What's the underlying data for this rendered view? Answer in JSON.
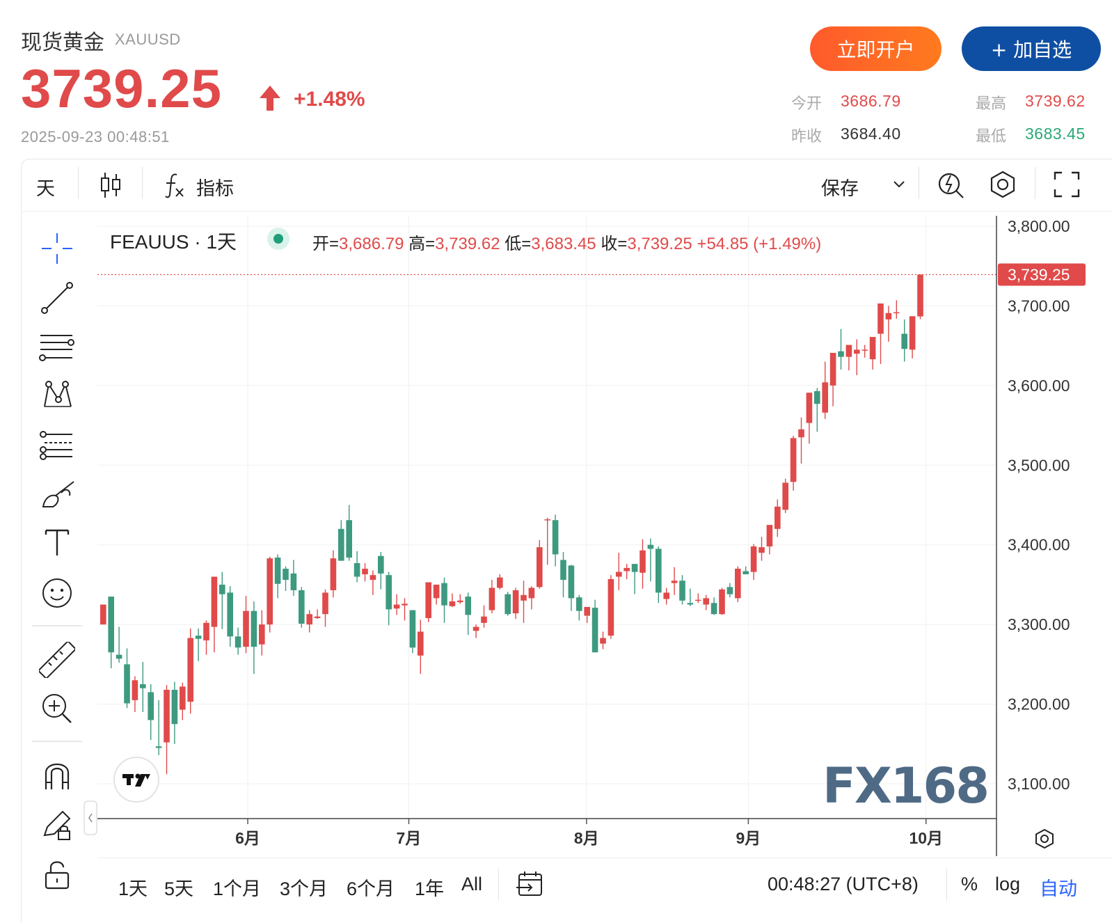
{
  "header": {
    "name": "现货黄金",
    "symbol": "XAUUSD",
    "price": "3739.25",
    "change_pct": "+1.48%",
    "timestamp": "2025-09-23 00:48:51",
    "open_label": "今开",
    "open_value": "3686.79",
    "prev_close_label": "昨收",
    "prev_close_value": "3684.40",
    "high_label": "最高",
    "high_value": "3739.62",
    "low_label": "最低",
    "low_value": "3683.45",
    "btn_open_account": "立即开户",
    "btn_watchlist": "+ 加自选"
  },
  "toolbar": {
    "interval": "天",
    "indicators": "指标",
    "save": "保存"
  },
  "legend": {
    "title": "FEAUUS · 1天",
    "o_label": "开=",
    "o": "3,686.79",
    "h_label": "高=",
    "h": "3,739.62",
    "l_label": "低=",
    "l": "3,683.45",
    "c_label": "收=",
    "c": "3,739.25",
    "chg": "+54.85 (+1.49%)"
  },
  "bottom": {
    "ranges": [
      "1天",
      "5天",
      "1个月",
      "3个月",
      "6个月",
      "1年",
      "All"
    ],
    "clock": "00:48:27 (UTC+8)",
    "pct": "%",
    "log": "log",
    "auto": "自动"
  },
  "watermark": "FX168",
  "colors": {
    "up": "#e04a4a",
    "down": "#3d9a7f",
    "accent": "#0f4fa3",
    "orange": "#ff6a24"
  },
  "chart_data": {
    "type": "candlestick",
    "price_axis": {
      "ticks": [
        3100,
        3200,
        3300,
        3400,
        3500,
        3600,
        3700,
        3800
      ],
      "tick_labels": [
        "3,100.00",
        "3,200.00",
        "3,300.00",
        "3,400.00",
        "3,500.00",
        "3,600.00",
        "3,700.00",
        "3,800.00"
      ],
      "range": [
        3060,
        3815
      ],
      "last_price_label": "3,739.25",
      "last_price": 3739.25
    },
    "time_axis": {
      "labels": [
        "6月",
        "7月",
        "8月",
        "9月",
        "10月"
      ],
      "label_bar_index": [
        18.6,
        38.9,
        61.3,
        81.7,
        104.1
      ]
    },
    "candles": [
      {
        "o": 3300,
        "h": 3325,
        "l": 3300,
        "c": 3325
      },
      {
        "o": 3335,
        "h": 3335,
        "l": 3245,
        "c": 3265
      },
      {
        "o": 3262,
        "h": 3297,
        "l": 3252,
        "c": 3257
      },
      {
        "o": 3250,
        "h": 3270,
        "l": 3195,
        "c": 3201
      },
      {
        "o": 3205,
        "h": 3235,
        "l": 3190,
        "c": 3230
      },
      {
        "o": 3225,
        "h": 3253,
        "l": 3190,
        "c": 3220
      },
      {
        "o": 3215,
        "h": 3225,
        "l": 3155,
        "c": 3180
      },
      {
        "o": 3147,
        "h": 3205,
        "l": 3136,
        "c": 3145
      },
      {
        "o": 3152,
        "h": 3224,
        "l": 3112,
        "c": 3218
      },
      {
        "o": 3218,
        "h": 3228,
        "l": 3150,
        "c": 3175
      },
      {
        "o": 3193,
        "h": 3227,
        "l": 3180,
        "c": 3222
      },
      {
        "o": 3203,
        "h": 3295,
        "l": 3188,
        "c": 3283
      },
      {
        "o": 3286,
        "h": 3295,
        "l": 3254,
        "c": 3282
      },
      {
        "o": 3280,
        "h": 3305,
        "l": 3262,
        "c": 3302
      },
      {
        "o": 3297,
        "h": 3338,
        "l": 3265,
        "c": 3360
      },
      {
        "o": 3350,
        "h": 3366,
        "l": 3294,
        "c": 3338
      },
      {
        "o": 3340,
        "h": 3348,
        "l": 3272,
        "c": 3285
      },
      {
        "o": 3285,
        "h": 3296,
        "l": 3262,
        "c": 3271
      },
      {
        "o": 3272,
        "h": 3336,
        "l": 3264,
        "c": 3317
      },
      {
        "o": 3317,
        "h": 3329,
        "l": 3238,
        "c": 3272
      },
      {
        "o": 3275,
        "h": 3318,
        "l": 3261,
        "c": 3300
      },
      {
        "o": 3300,
        "h": 3385,
        "l": 3290,
        "c": 3383
      },
      {
        "o": 3384,
        "h": 3388,
        "l": 3333,
        "c": 3351
      },
      {
        "o": 3370,
        "h": 3373,
        "l": 3342,
        "c": 3356
      },
      {
        "o": 3364,
        "h": 3381,
        "l": 3336,
        "c": 3343
      },
      {
        "o": 3343,
        "h": 3347,
        "l": 3296,
        "c": 3301
      },
      {
        "o": 3300,
        "h": 3318,
        "l": 3290,
        "c": 3313
      },
      {
        "o": 3308,
        "h": 3319,
        "l": 3307,
        "c": 3310
      },
      {
        "o": 3313,
        "h": 3344,
        "l": 3297,
        "c": 3340
      },
      {
        "o": 3343,
        "h": 3393,
        "l": 3334,
        "c": 3383
      },
      {
        "o": 3420,
        "h": 3431,
        "l": 3380,
        "c": 3380
      },
      {
        "o": 3431,
        "h": 3450,
        "l": 3380,
        "c": 3384
      },
      {
        "o": 3377,
        "h": 3392,
        "l": 3353,
        "c": 3360
      },
      {
        "o": 3363,
        "h": 3377,
        "l": 3354,
        "c": 3370
      },
      {
        "o": 3356,
        "h": 3368,
        "l": 3337,
        "c": 3362
      },
      {
        "o": 3386,
        "h": 3391,
        "l": 3344,
        "c": 3364
      },
      {
        "o": 3362,
        "h": 3366,
        "l": 3299,
        "c": 3319
      },
      {
        "o": 3320,
        "h": 3338,
        "l": 3312,
        "c": 3325
      },
      {
        "o": 3324,
        "h": 3333,
        "l": 3305,
        "c": 3326
      },
      {
        "o": 3318,
        "h": 3318,
        "l": 3264,
        "c": 3271
      },
      {
        "o": 3261,
        "h": 3306,
        "l": 3238,
        "c": 3291
      },
      {
        "o": 3308,
        "h": 3350,
        "l": 3303,
        "c": 3353
      },
      {
        "o": 3333,
        "h": 3345,
        "l": 3325,
        "c": 3350
      },
      {
        "o": 3352,
        "h": 3359,
        "l": 3302,
        "c": 3324
      },
      {
        "o": 3323,
        "h": 3339,
        "l": 3322,
        "c": 3329
      },
      {
        "o": 3328,
        "h": 3338,
        "l": 3326,
        "c": 3330
      },
      {
        "o": 3335,
        "h": 3340,
        "l": 3287,
        "c": 3312
      },
      {
        "o": 3292,
        "h": 3300,
        "l": 3283,
        "c": 3297
      },
      {
        "o": 3302,
        "h": 3324,
        "l": 3296,
        "c": 3310
      },
      {
        "o": 3318,
        "h": 3356,
        "l": 3314,
        "c": 3346
      },
      {
        "o": 3346,
        "h": 3363,
        "l": 3344,
        "c": 3359
      },
      {
        "o": 3338,
        "h": 3341,
        "l": 3311,
        "c": 3313
      },
      {
        "o": 3314,
        "h": 3346,
        "l": 3307,
        "c": 3343
      },
      {
        "o": 3330,
        "h": 3355,
        "l": 3302,
        "c": 3337
      },
      {
        "o": 3333,
        "h": 3348,
        "l": 3319,
        "c": 3346
      },
      {
        "o": 3347,
        "h": 3406,
        "l": 3345,
        "c": 3397
      },
      {
        "o": 3431,
        "h": 3434,
        "l": 3375,
        "c": 3432
      },
      {
        "o": 3431,
        "h": 3438,
        "l": 3373,
        "c": 3388
      },
      {
        "o": 3381,
        "h": 3391,
        "l": 3334,
        "c": 3356
      },
      {
        "o": 3374,
        "h": 3375,
        "l": 3317,
        "c": 3333
      },
      {
        "o": 3334,
        "h": 3337,
        "l": 3305,
        "c": 3317
      },
      {
        "o": 3311,
        "h": 3320,
        "l": 3302,
        "c": 3322
      },
      {
        "o": 3321,
        "h": 3331,
        "l": 3265,
        "c": 3265
      },
      {
        "o": 3276,
        "h": 3291,
        "l": 3269,
        "c": 3283
      },
      {
        "o": 3286,
        "h": 3362,
        "l": 3282,
        "c": 3357
      },
      {
        "o": 3360,
        "h": 3390,
        "l": 3343,
        "c": 3366
      },
      {
        "o": 3367,
        "h": 3376,
        "l": 3357,
        "c": 3371
      },
      {
        "o": 3376,
        "h": 3376,
        "l": 3338,
        "c": 3366
      },
      {
        "o": 3365,
        "h": 3407,
        "l": 3345,
        "c": 3393
      },
      {
        "o": 3400,
        "h": 3408,
        "l": 3354,
        "c": 3395
      },
      {
        "o": 3395,
        "h": 3398,
        "l": 3327,
        "c": 3340
      },
      {
        "o": 3332,
        "h": 3346,
        "l": 3325,
        "c": 3340
      },
      {
        "o": 3352,
        "h": 3372,
        "l": 3337,
        "c": 3355
      },
      {
        "o": 3355,
        "h": 3362,
        "l": 3325,
        "c": 3330
      },
      {
        "o": 3327,
        "h": 3345,
        "l": 3323,
        "c": 3325
      },
      {
        "o": 3331,
        "h": 3339,
        "l": 3327,
        "c": 3331
      },
      {
        "o": 3325,
        "h": 3337,
        "l": 3318,
        "c": 3333
      },
      {
        "o": 3327,
        "h": 3334,
        "l": 3312,
        "c": 3313
      },
      {
        "o": 3313,
        "h": 3346,
        "l": 3312,
        "c": 3344
      },
      {
        "o": 3347,
        "h": 3352,
        "l": 3334,
        "c": 3338
      },
      {
        "o": 3333,
        "h": 3373,
        "l": 3328,
        "c": 3370
      },
      {
        "o": 3367,
        "h": 3373,
        "l": 3363,
        "c": 3363
      },
      {
        "o": 3366,
        "h": 3401,
        "l": 3356,
        "c": 3398
      },
      {
        "o": 3390,
        "h": 3410,
        "l": 3380,
        "c": 3397
      },
      {
        "o": 3398,
        "h": 3425,
        "l": 3388,
        "c": 3425
      },
      {
        "o": 3420,
        "h": 3457,
        "l": 3410,
        "c": 3448
      },
      {
        "o": 3444,
        "h": 3483,
        "l": 3440,
        "c": 3478
      },
      {
        "o": 3479,
        "h": 3537,
        "l": 3468,
        "c": 3534
      },
      {
        "o": 3535,
        "h": 3560,
        "l": 3502,
        "c": 3545
      },
      {
        "o": 3553,
        "h": 3581,
        "l": 3527,
        "c": 3591
      },
      {
        "o": 3593,
        "h": 3597,
        "l": 3542,
        "c": 3577
      },
      {
        "o": 3566,
        "h": 3630,
        "l": 3558,
        "c": 3604
      },
      {
        "o": 3600,
        "h": 3638,
        "l": 3574,
        "c": 3641
      },
      {
        "o": 3643,
        "h": 3671,
        "l": 3620,
        "c": 3636
      },
      {
        "o": 3636,
        "h": 3647,
        "l": 3619,
        "c": 3651
      },
      {
        "o": 3640,
        "h": 3658,
        "l": 3613,
        "c": 3645
      },
      {
        "o": 3644,
        "h": 3651,
        "l": 3635,
        "c": 3645
      },
      {
        "o": 3633,
        "h": 3660,
        "l": 3620,
        "c": 3661
      },
      {
        "o": 3665,
        "h": 3696,
        "l": 3627,
        "c": 3703
      },
      {
        "o": 3683,
        "h": 3700,
        "l": 3655,
        "c": 3691
      },
      {
        "o": 3692,
        "h": 3707,
        "l": 3684,
        "c": 3692
      },
      {
        "o": 3665,
        "h": 3683,
        "l": 3630,
        "c": 3646
      },
      {
        "o": 3645,
        "h": 3687,
        "l": 3634,
        "c": 3687
      },
      {
        "o": 3686.79,
        "h": 3739.62,
        "l": 3683.45,
        "c": 3739.25
      }
    ]
  }
}
